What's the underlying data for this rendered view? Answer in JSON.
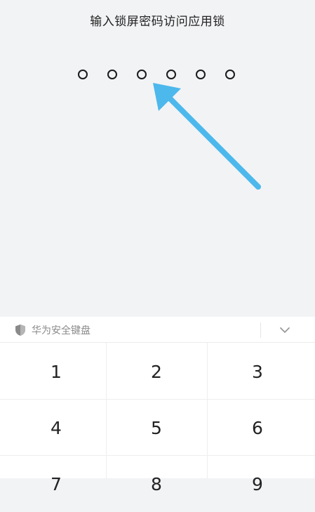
{
  "lock_screen": {
    "title": "输入锁屏密码访问应用锁",
    "pin_length": 6
  },
  "keyboard": {
    "brand_label": "华为安全键盘",
    "brand_icon": "shield-icon",
    "collapse_icon": "chevron-down-icon",
    "keys": [
      "1",
      "2",
      "3",
      "4",
      "5",
      "6",
      "7",
      "8",
      "9"
    ]
  },
  "annotation": {
    "arrow_color": "#4cb8ec"
  },
  "colors": {
    "page_background": "#f2f3f5",
    "keyboard_background": "#ffffff"
  }
}
